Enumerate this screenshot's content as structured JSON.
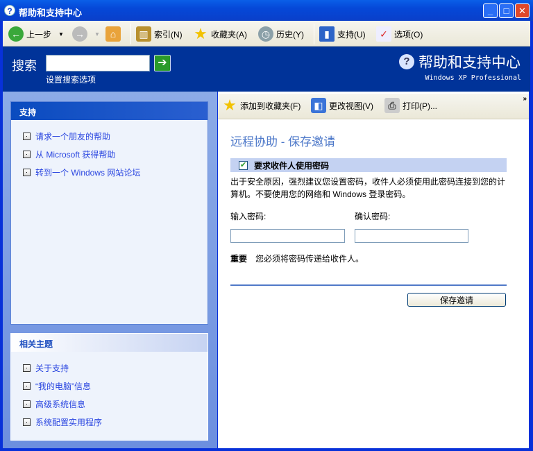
{
  "window": {
    "title": "帮助和支持中心"
  },
  "toolbar": {
    "back": "上一步",
    "index": "索引(N)",
    "favorites": "收藏夹(A)",
    "history": "历史(Y)",
    "support": "支持(U)",
    "options": "选项(O)"
  },
  "search": {
    "label": "搜索",
    "value": "",
    "options_link": "设置搜索选项"
  },
  "brand": {
    "title": "帮助和支持中心",
    "subtitle": "Windows XP Professional"
  },
  "sidebar": {
    "support": {
      "title": "支持",
      "items": [
        {
          "label": "请求一个朋友的帮助"
        },
        {
          "label": "从 Microsoft 获得帮助"
        },
        {
          "label": "转到一个 Windows 网站论坛"
        }
      ]
    },
    "related": {
      "title": "相关主题",
      "items": [
        {
          "label": "关于支持"
        },
        {
          "label": "“我的电脑”信息"
        },
        {
          "label": "高级系统信息"
        },
        {
          "label": "系统配置实用程序"
        }
      ]
    }
  },
  "content_toolbar": {
    "add_favorites": "添加到收藏夹(F)",
    "change_view": "更改视图(V)",
    "print": "打印(P)...",
    "more": "»"
  },
  "main": {
    "title": "远程协助 - 保存邀请",
    "require_password": "要求收件人使用密码",
    "require_password_checked": true,
    "description": "出于安全原因，强烈建议您设置密码，收件人必须使用此密码连接到您的计算机。不要使用您的网络和 Windows 登录密码。",
    "password_label": "输入密码:",
    "confirm_label": "确认密码:",
    "password_value": "",
    "confirm_value": "",
    "important_label": "重要",
    "important_text": "您必须将密码传递给收件人。",
    "save_button": "保存邀请"
  }
}
